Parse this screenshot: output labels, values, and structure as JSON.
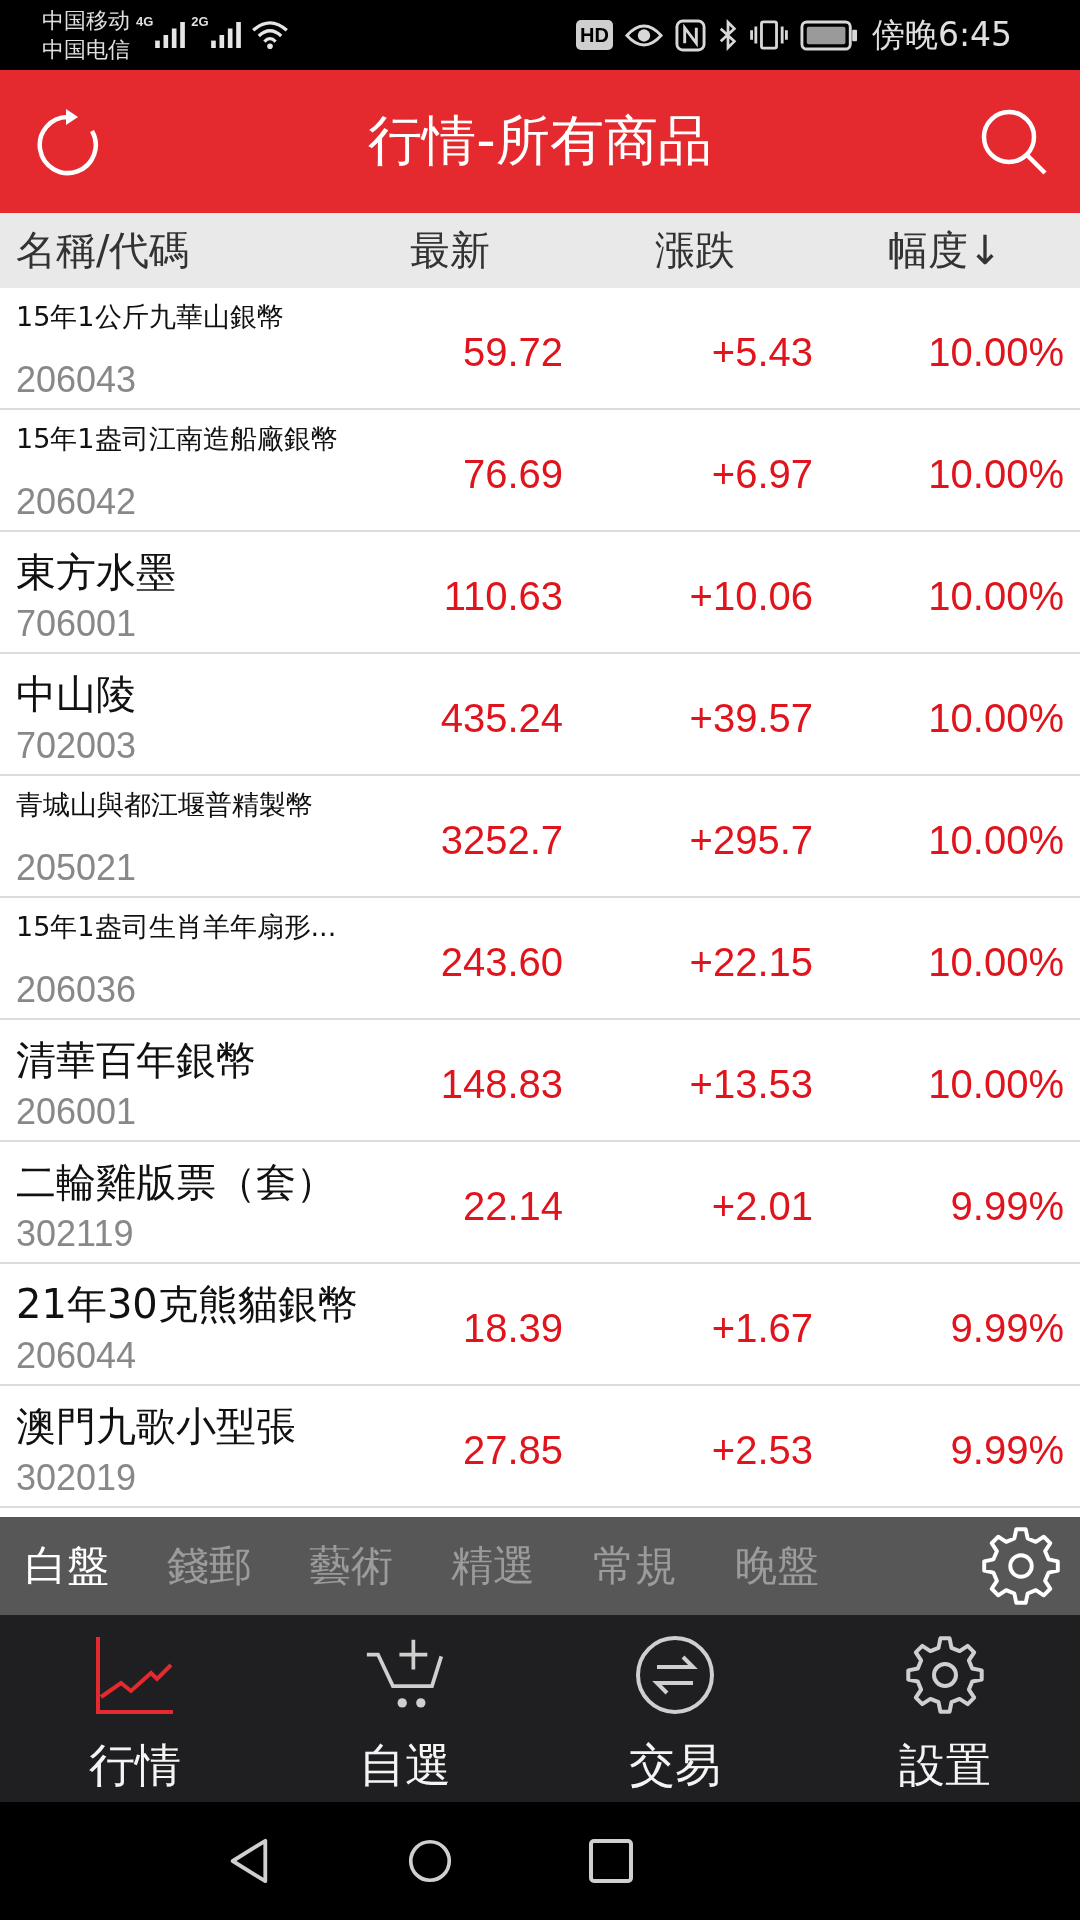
{
  "status_bar": {
    "carriers": [
      "中国移动",
      "中国电信"
    ],
    "network_types": [
      "4G",
      "2G"
    ],
    "hd_badge": "HD",
    "time": "傍晚6:45"
  },
  "header": {
    "title": "行情-所有商品"
  },
  "table": {
    "columns": [
      "名稱/代碼",
      "最新",
      "漲跌",
      "幅度↓"
    ],
    "rows": [
      {
        "kind": "compact",
        "name": "15年1公斤九華山銀幣",
        "code": "206043",
        "latest": "59.72",
        "change": "+5.43",
        "percent": "10.00%"
      },
      {
        "kind": "compact",
        "name": "15年1盎司江南造船廠銀幣",
        "code": "206042",
        "latest": "76.69",
        "change": "+6.97",
        "percent": "10.00%"
      },
      {
        "kind": "regular",
        "name": "東方水墨",
        "code": "706001",
        "latest": "110.63",
        "change": "+10.06",
        "percent": "10.00%"
      },
      {
        "kind": "regular",
        "name": "中山陵",
        "code": "702003",
        "latest": "435.24",
        "change": "+39.57",
        "percent": "10.00%"
      },
      {
        "kind": "compact",
        "name": "青城山與都江堰普精製幣",
        "code": "205021",
        "latest": "3252.7",
        "change": "+295.7",
        "percent": "10.00%"
      },
      {
        "kind": "compact",
        "name": "15年1盎司生肖羊年扇形...",
        "code": "206036",
        "latest": "243.60",
        "change": "+22.15",
        "percent": "10.00%"
      },
      {
        "kind": "regular",
        "name": "清華百年銀幣",
        "code": "206001",
        "latest": "148.83",
        "change": "+13.53",
        "percent": "10.00%"
      },
      {
        "kind": "regular",
        "name": "二輪雞版票（套）",
        "code": "302119",
        "latest": "22.14",
        "change": "+2.01",
        "percent": "9.99%"
      },
      {
        "kind": "regular",
        "name": "21年30克熊貓銀幣",
        "code": "206044",
        "latest": "18.39",
        "change": "+1.67",
        "percent": "9.99%"
      },
      {
        "kind": "regular",
        "name": "澳門九歌小型張",
        "code": "302019",
        "latest": "27.85",
        "change": "+2.53",
        "percent": "9.99%"
      }
    ]
  },
  "market_tabs": [
    {
      "label": "白盤",
      "selected": true
    },
    {
      "label": "錢郵",
      "selected": false
    },
    {
      "label": "藝術",
      "selected": false
    },
    {
      "label": "精選",
      "selected": false
    },
    {
      "label": "常規",
      "selected": false
    },
    {
      "label": "晚盤",
      "selected": false
    }
  ],
  "bottom_nav": [
    {
      "label": "行情",
      "selected": true
    },
    {
      "label": "自選",
      "selected": false
    },
    {
      "label": "交易",
      "selected": false
    },
    {
      "label": "設置",
      "selected": false
    }
  ]
}
